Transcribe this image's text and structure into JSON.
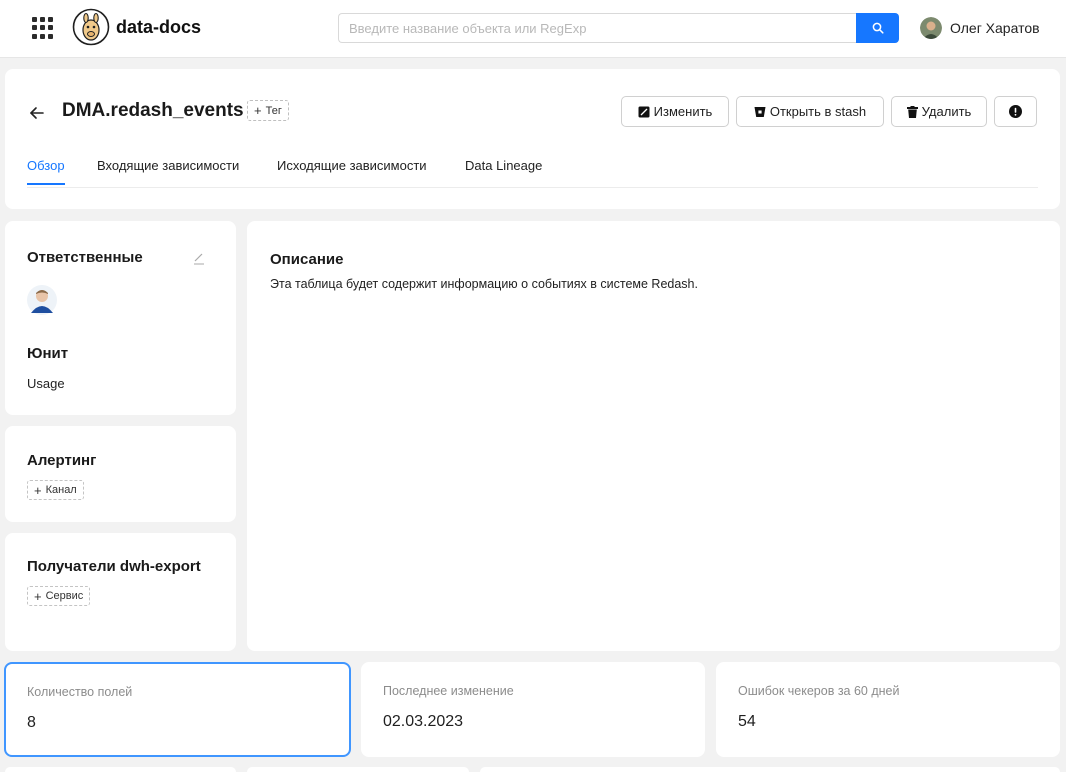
{
  "header": {
    "brand": "data-docs",
    "search_placeholder": "Введите название объекта или RegExp",
    "user_name": "Олег Харатов",
    "icons": [
      "apps-grid-icon",
      "logo-llama-icon",
      "search-icon",
      "user-avatar"
    ]
  },
  "object": {
    "title": "DMA.redash_events",
    "tag_button": "Тег",
    "actions": {
      "edit": "Изменить",
      "stash": "Открыть в stash",
      "delete": "Удалить"
    },
    "tabs": [
      {
        "label": "Обзор",
        "active": true
      },
      {
        "label": "Входящие зависимости",
        "active": false
      },
      {
        "label": "Исходящие зависимости",
        "active": false
      },
      {
        "label": "Data Lineage",
        "active": false
      }
    ]
  },
  "sidebar": {
    "owners_title": "Ответственные",
    "unit_title": "Юнит",
    "unit_value": "Usage",
    "alerting_title": "Алертинг",
    "alerting_button": "Канал",
    "recipients_title": "Получатели dwh-export",
    "recipients_button": "Сервис"
  },
  "description": {
    "title": "Описание",
    "text": "Эта таблица будет содержит информацию о событиях в системе Redash."
  },
  "stats": [
    {
      "label": "Количество полей",
      "value": "8",
      "selected": true
    },
    {
      "label": "Последнее изменение",
      "value": "02.03.2023",
      "selected": false
    },
    {
      "label": "Ошибок чекеров за 60 дней",
      "value": "54",
      "selected": false
    }
  ],
  "colors": {
    "accent": "#1677ff",
    "background": "#f2f2f2",
    "card": "#ffffff"
  }
}
